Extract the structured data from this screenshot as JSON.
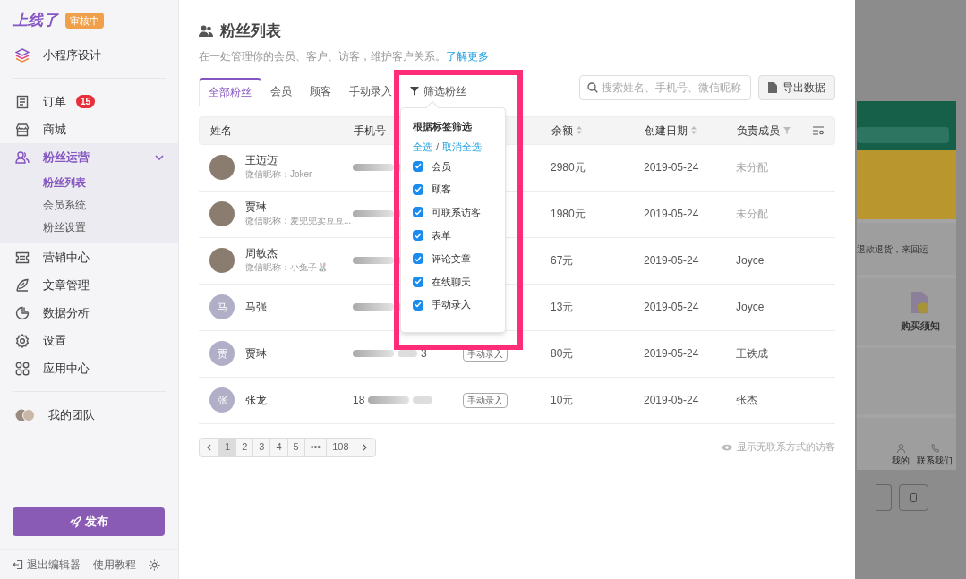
{
  "sidebar": {
    "logo": "上线了",
    "status_badge": "审核中",
    "groups": [
      [
        {
          "label": "小程序设计",
          "selected": false,
          "expanded": false
        }
      ],
      [
        {
          "label": "订单",
          "badge": "15",
          "selected": false,
          "expanded": false
        },
        {
          "label": "商城",
          "selected": false,
          "expanded": false
        },
        {
          "label": "粉丝运营",
          "selected": true,
          "expanded": true,
          "children": [
            {
              "label": "粉丝列表",
              "selected": true
            },
            {
              "label": "会员系统",
              "selected": false
            },
            {
              "label": "粉丝设置",
              "selected": false
            }
          ]
        },
        {
          "label": "营销中心",
          "selected": false,
          "expanded": false
        },
        {
          "label": "文章管理",
          "selected": false,
          "expanded": false
        },
        {
          "label": "数据分析",
          "selected": false,
          "expanded": false
        },
        {
          "label": "设置",
          "selected": false,
          "expanded": false
        },
        {
          "label": "应用中心",
          "selected": false,
          "expanded": false
        }
      ],
      [
        {
          "label": "我的团队",
          "selected": false,
          "expanded": false
        }
      ]
    ],
    "publish_button": "发布",
    "footer": {
      "exit": "退出编辑器",
      "tutorial": "使用教程"
    }
  },
  "page": {
    "title": "粉丝列表",
    "subtitle": "在一处管理你的会员、客户、访客，维护客户关系。",
    "learn_more": "了解更多"
  },
  "tabs": [
    {
      "label": "全部粉丝",
      "selected": true
    },
    {
      "label": "会员",
      "selected": false
    },
    {
      "label": "顾客",
      "selected": false
    },
    {
      "label": "手动录入",
      "selected": false
    },
    {
      "label": "筛选粉丝",
      "selected": false,
      "kind": "filter"
    }
  ],
  "search": {
    "placeholder": "搜索姓名、手机号、微信昵称"
  },
  "export_button": "导出数据",
  "table": {
    "columns": [
      {
        "label": "姓名",
        "kind": "plain"
      },
      {
        "label": "手机号",
        "kind": "plain"
      },
      {
        "kind": "hidden"
      },
      {
        "label": "余额",
        "kind": "sort"
      },
      {
        "label": "创建日期",
        "kind": "sort"
      },
      {
        "label": "负责成员",
        "kind": "filter"
      }
    ],
    "rows": [
      {
        "avatar": {
          "kind": "photo"
        },
        "name": "王迈迈",
        "nickname": "微信昵称：Joker",
        "balance": "2980元",
        "date": "2019-05-24",
        "member": "未分配",
        "assigned": false
      },
      {
        "avatar": {
          "kind": "photo"
        },
        "name": "贾琳",
        "nickname": "微信昵称：麦兜兜卖豆豆...",
        "balance": "1980元",
        "date": "2019-05-24",
        "member": "未分配",
        "assigned": false
      },
      {
        "avatar": {
          "kind": "photo"
        },
        "name": "周敏杰",
        "nickname": "微信昵称：小兔子🐰",
        "balance": "67元",
        "date": "2019-05-24",
        "member": "Joyce",
        "assigned": true
      },
      {
        "avatar": {
          "kind": "initial",
          "text": "马"
        },
        "name": "马强",
        "balance": "13元",
        "date": "2019-05-24",
        "member": "Joyce",
        "assigned": true
      },
      {
        "avatar": {
          "kind": "initial",
          "text": "贾"
        },
        "name": "贾琳",
        "phone_suffix": "3",
        "tag": "手动录入",
        "balance": "80元",
        "date": "2019-05-24",
        "member": "王铁成",
        "assigned": true
      },
      {
        "avatar": {
          "kind": "initial",
          "text": "张"
        },
        "name": "张龙",
        "phone_prefix": "18",
        "tag": "手动录入",
        "balance": "10元",
        "date": "2019-05-24",
        "member": "张杰",
        "assigned": true
      }
    ]
  },
  "pagination": {
    "pages": [
      {
        "label": "1",
        "selected": true
      },
      {
        "label": "2",
        "selected": false
      },
      {
        "label": "3",
        "selected": false
      },
      {
        "label": "4",
        "selected": false
      },
      {
        "label": "5",
        "selected": false
      },
      {
        "label": "•••",
        "selected": false
      },
      {
        "label": "108",
        "selected": false
      }
    ]
  },
  "show_hidden_visitors": "显示无联系方式的访客",
  "filter_menu": {
    "title": "根据标签筛选",
    "select_all": "全选",
    "separator": "/",
    "deselect_all": "取消全选",
    "options": [
      {
        "label": "会员",
        "checked": true
      },
      {
        "label": "顾客",
        "checked": true
      },
      {
        "label": "可联系访客",
        "checked": true
      },
      {
        "label": "表单",
        "checked": true
      },
      {
        "label": "评论文章",
        "checked": true
      },
      {
        "label": "在线聊天",
        "checked": true
      },
      {
        "label": "手动录入",
        "checked": true
      }
    ]
  },
  "preview": {
    "notice_text": "退款退货，来回运",
    "notice_label": "购买须知",
    "nav": [
      "我的",
      "联系我们"
    ]
  }
}
